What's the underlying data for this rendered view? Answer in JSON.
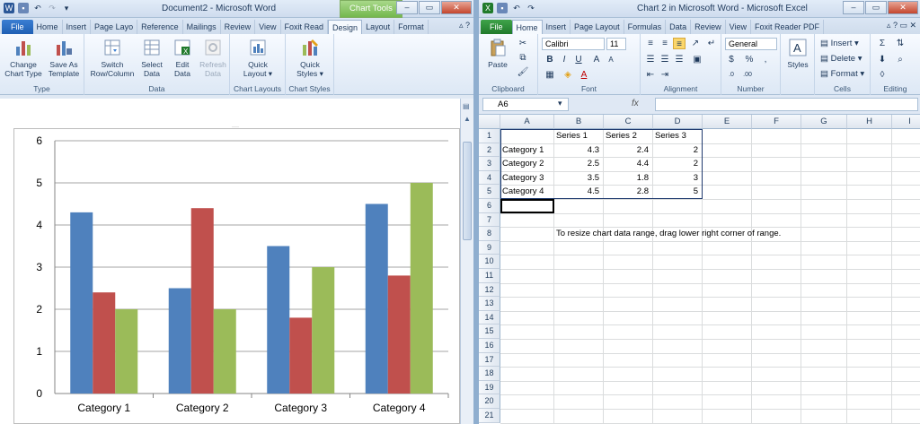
{
  "word": {
    "title": "Document2  -  Microsoft Word",
    "context_tab": "Chart Tools",
    "tabs": [
      "File",
      "Home",
      "Insert",
      "Page Layo",
      "Reference",
      "Mailings",
      "Review",
      "View",
      "Foxit Read",
      "Design",
      "Layout",
      "Format"
    ],
    "active_tab": "Design",
    "ribbon": {
      "type_group": "Type",
      "change_chart_type": [
        "Change",
        "Chart Type"
      ],
      "save_as_template": [
        "Save As",
        "Template"
      ],
      "data_group": "Data",
      "switch_row_column": [
        "Switch",
        "Row/Column"
      ],
      "select_data": [
        "Select",
        "Data"
      ],
      "edit_data": [
        "Edit",
        "Data"
      ],
      "refresh_data": [
        "Refresh",
        "Data"
      ],
      "chart_layouts_group": "Chart Layouts",
      "quick_layout": [
        "Quick",
        "Layout ▾"
      ],
      "chart_styles_group": "Chart Styles",
      "quick_styles": [
        "Quick",
        "Styles ▾"
      ]
    }
  },
  "excel": {
    "title": "Chart 2 in Microsoft Word  -  Microsoft Excel",
    "tabs": [
      "File",
      "Home",
      "Insert",
      "Page Layout",
      "Formulas",
      "Data",
      "Review",
      "View",
      "Foxit Reader PDF"
    ],
    "active_tab": "Home",
    "ribbon": {
      "paste": "Paste",
      "clipboard": "Clipboard",
      "font_name": "Calibri",
      "font_size": "11",
      "font_group": "Font",
      "alignment_group": "Alignment",
      "number_format": "General",
      "number_group": "Number",
      "styles": "Styles",
      "insert": "Insert ▾",
      "delete": "Delete ▾",
      "format": "Format ▾",
      "cells_group": "Cells",
      "editing_group": "Editing"
    },
    "name_box": "A6",
    "fx": "fx",
    "columns": [
      "A",
      "B",
      "C",
      "D",
      "E",
      "F",
      "G",
      "H",
      "I"
    ],
    "rows": [
      "1",
      "2",
      "3",
      "4",
      "5",
      "6",
      "7",
      "8",
      "9",
      "10",
      "11",
      "12",
      "13",
      "14",
      "15",
      "16",
      "17",
      "18",
      "19",
      "20",
      "21"
    ],
    "headers": [
      "Series 1",
      "Series 2",
      "Series 3"
    ],
    "data_rows": [
      {
        "label": "Category 1",
        "values": [
          "4.3",
          "2.4",
          "2"
        ]
      },
      {
        "label": "Category 2",
        "values": [
          "2.5",
          "4.4",
          "2"
        ]
      },
      {
        "label": "Category 3",
        "values": [
          "3.5",
          "1.8",
          "3"
        ]
      },
      {
        "label": "Category 4",
        "values": [
          "4.5",
          "2.8",
          "5"
        ]
      }
    ],
    "note": "To resize chart data range, drag lower right corner of range."
  },
  "chart_data": {
    "type": "bar",
    "categories": [
      "Category 1",
      "Category 2",
      "Category 3",
      "Category 4"
    ],
    "series": [
      {
        "name": "Series 1",
        "values": [
          4.3,
          2.5,
          3.5,
          4.5
        ],
        "color": "#4f81bd"
      },
      {
        "name": "Series 2",
        "values": [
          2.4,
          4.4,
          1.8,
          2.8
        ],
        "color": "#c0504d"
      },
      {
        "name": "Series 3",
        "values": [
          2,
          2,
          3,
          5
        ],
        "color": "#9bbb59"
      }
    ],
    "ylim": [
      0,
      6
    ],
    "yticks": [
      "0",
      "1",
      "2",
      "3",
      "4",
      "5",
      "6"
    ],
    "grid": true
  }
}
